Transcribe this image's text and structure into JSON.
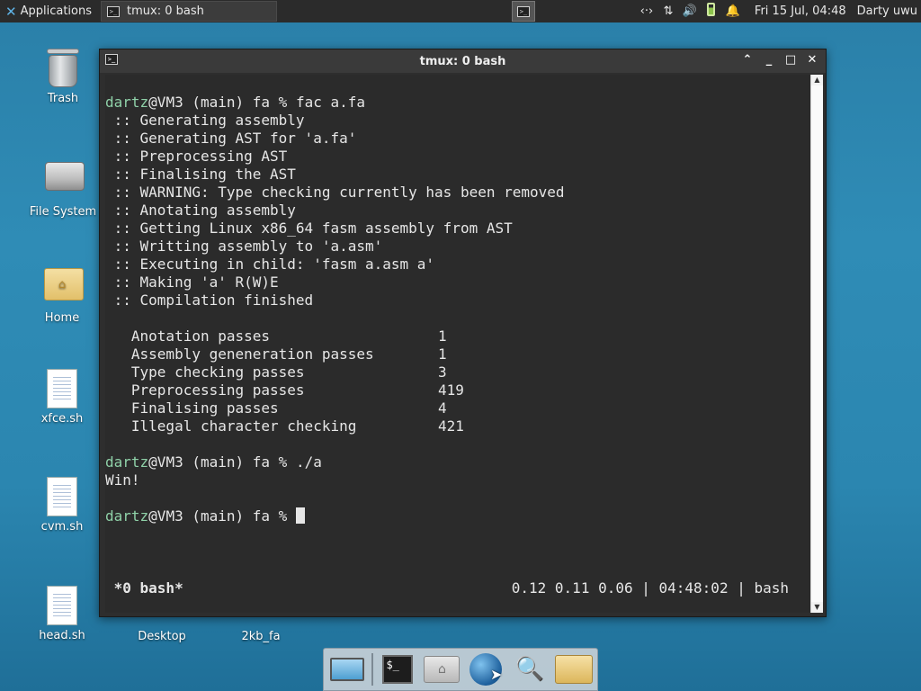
{
  "top_panel": {
    "applications_label": "Applications",
    "task_title": "tmux: 0 bash",
    "clock": "Fri 15 Jul, 04:48",
    "user": "Darty uwu",
    "tray_icons": [
      "network-icon",
      "transfer-icon",
      "volume-icon",
      "battery-icon",
      "notification-bell-icon"
    ],
    "tray_glyphs": {
      "network": "‹·›",
      "transfer": "⇅",
      "volume": "🔊",
      "bell": "🔔"
    }
  },
  "desktop_icons": [
    {
      "label": "Trash",
      "icon": "trash-icon"
    },
    {
      "label": "File System",
      "icon": "drive-icon"
    },
    {
      "label": "Home",
      "icon": "home-folder-icon"
    },
    {
      "label": "xfce.sh",
      "icon": "script-file-icon"
    },
    {
      "label": "cvm.sh",
      "icon": "script-file-icon"
    },
    {
      "label": "head.sh",
      "icon": "script-file-icon"
    },
    {
      "label": "Desktop",
      "icon": "folder-icon"
    },
    {
      "label": "2kb_fa",
      "icon": "executable-icon"
    }
  ],
  "window": {
    "title": "tmux: 0 bash",
    "controls": {
      "up": "⌃",
      "minimize": "_",
      "maximize": "□",
      "close": "✕"
    }
  },
  "terminal": {
    "prompt_user": "dartz",
    "prompt_rest": "@VM3 (main) fa % ",
    "cmd1": "fac a.fa",
    "output": [
      " :: Generating assembly",
      " :: Generating AST for 'a.fa'",
      " :: Preprocessing AST",
      " :: Finalising the AST",
      " :: WARNING: Type checking currently has been removed",
      " :: Anotating assembly",
      " :: Getting Linux x86_64 fasm assembly from AST",
      " :: Writting assembly to 'a.asm'",
      " :: Executing in child: 'fasm a.asm a'",
      " :: Making 'a' R(W)E",
      " :: Compilation finished"
    ],
    "stats": [
      {
        "label": "   Anotation passes",
        "value": "1"
      },
      {
        "label": "   Assembly geneneration passes",
        "value": "1"
      },
      {
        "label": "   Type checking passes",
        "value": "3"
      },
      {
        "label": "   Preprocessing passes",
        "value": "419"
      },
      {
        "label": "   Finalising passes",
        "value": "4"
      },
      {
        "label": "   Illegal character checking",
        "value": "421"
      }
    ],
    "cmd2": "./a",
    "cmd2_output": "Win!"
  },
  "tmux_status": {
    "left": " *0 bash*",
    "right": "0.12 0.11 0.06 | 04:48:02 | bash"
  },
  "dock": {
    "items": [
      "show-desktop-icon",
      "terminal-icon",
      "home-icon",
      "web-browser-icon",
      "search-icon",
      "folder-icon"
    ],
    "terminal_glyph": "$_",
    "home_glyph": "⌂",
    "search_glyph": "🔍",
    "pointer_glyph": "➤"
  }
}
